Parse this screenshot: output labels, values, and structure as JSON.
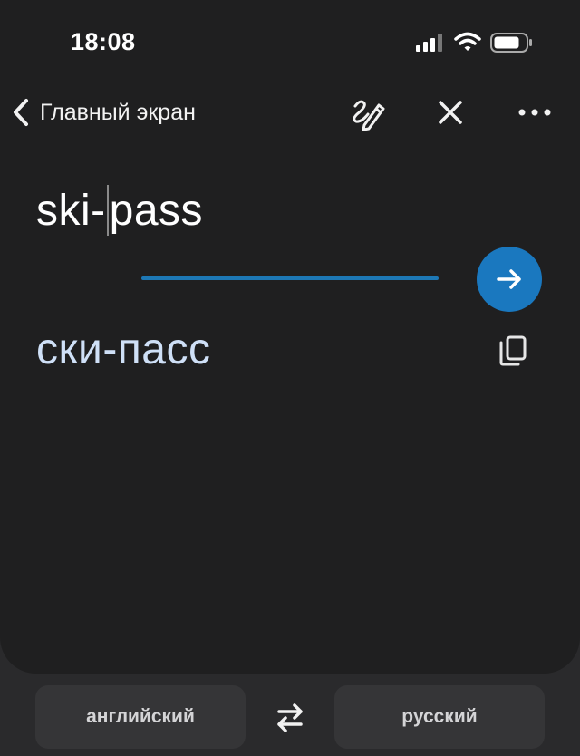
{
  "status_bar": {
    "time": "18:08"
  },
  "nav": {
    "back_label": "Главный экран",
    "icons": [
      "chevron-left-icon",
      "handwriting-icon",
      "close-icon",
      "more-icon"
    ]
  },
  "translator": {
    "source_text_before_caret": "ski-",
    "source_text_after_caret": "pass",
    "translation": "ски-пасс",
    "accent_color": "#1a78bf",
    "translation_color": "#cfe0f7"
  },
  "languages": {
    "source": "английский",
    "target": "русский"
  }
}
